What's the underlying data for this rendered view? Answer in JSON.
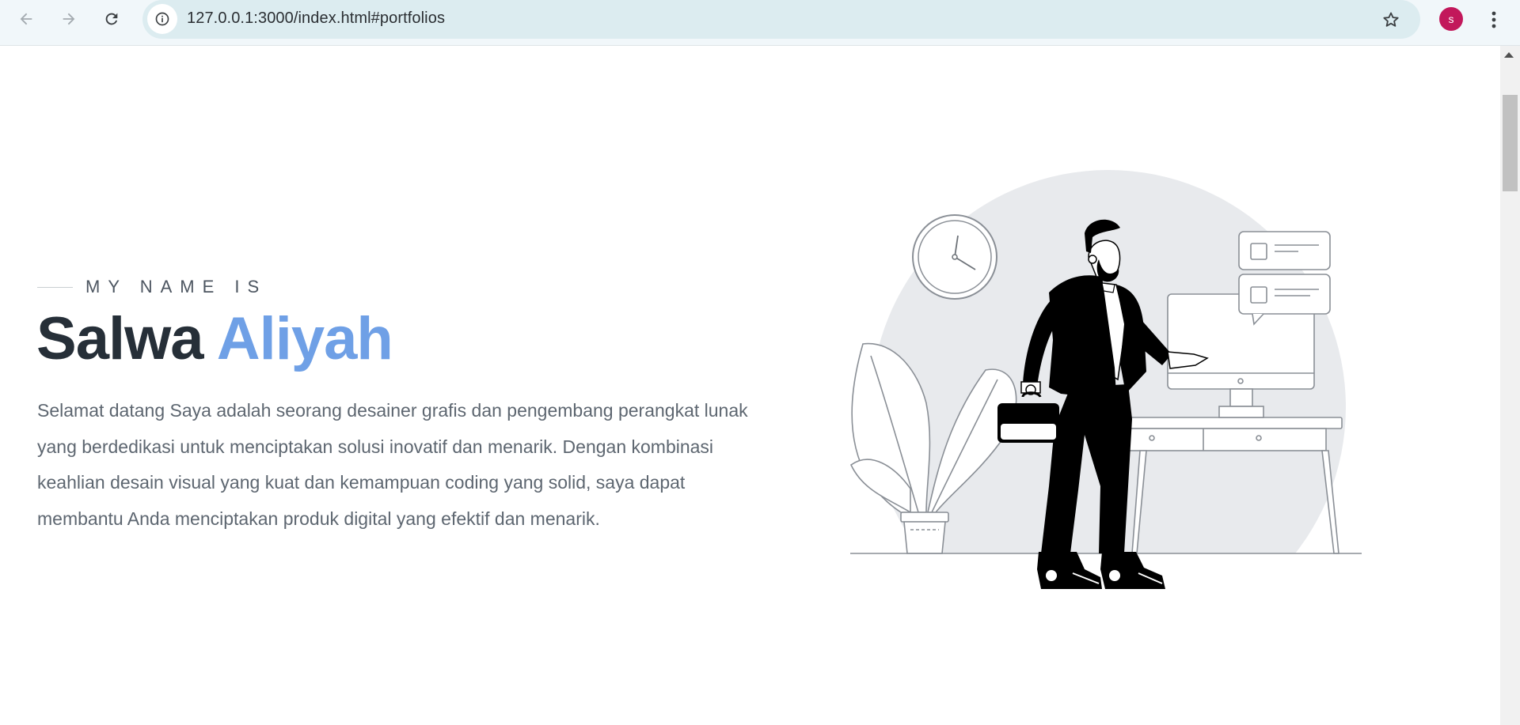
{
  "browser": {
    "url": "127.0.0.1:3000/index.html#portfolios",
    "profile_initial": "s",
    "profile_color": "#c2185b"
  },
  "icons": {
    "back": "arrow-left-icon",
    "forward": "arrow-right-icon",
    "reload": "reload-icon",
    "site_info": "info-icon",
    "bookmark": "star-icon",
    "menu": "kebab-menu-icon"
  },
  "hero": {
    "eyebrow": "MY NAME IS",
    "first_name": "Salwa",
    "last_name": "Aliyah",
    "description": "Selamat datang Saya adalah seorang desainer grafis dan pengembang perangkat lunak yang berdedikasi untuk menciptakan solusi inovatif dan menarik. Dengan kombinasi keahlian desain visual yang kuat dan kemampuan coding yang solid, saya dapat membantu Anda menciptakan produk digital yang efektif dan menarik."
  },
  "colors": {
    "accent": "#6fa0e6",
    "heading": "#262f38",
    "body_text": "#5d6670"
  }
}
